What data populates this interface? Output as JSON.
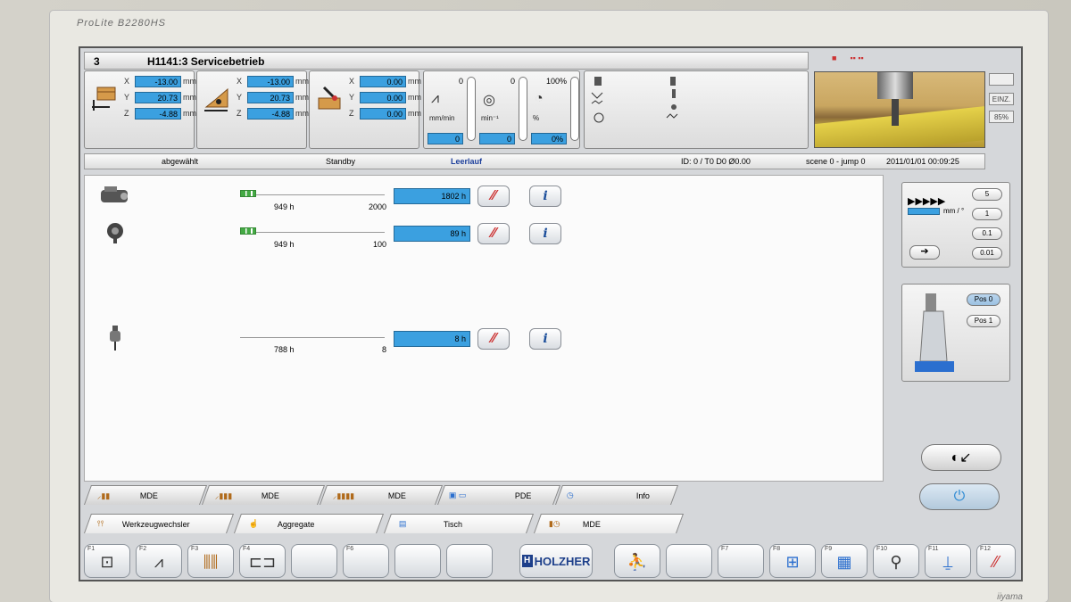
{
  "monitor": {
    "brand": "ProLite B2280HS",
    "maker": "iiyama"
  },
  "header": {
    "number": "3",
    "title": "H1141:3 Servicebetrieb"
  },
  "axes_panels": [
    {
      "x": "-13.00",
      "y": "20.73",
      "z": "-4.88",
      "unit": "mm"
    },
    {
      "x": "-13.00",
      "y": "20.73",
      "z": "-4.88",
      "unit": "mm"
    },
    {
      "x": "0.00",
      "y": "0.00",
      "z": "0.00",
      "unit": "mm"
    }
  ],
  "gauges": {
    "feed": {
      "top": "0",
      "unit": "mm/min",
      "value": "0"
    },
    "speed": {
      "top": "0",
      "unit": "min⁻¹",
      "value": "0"
    },
    "override": {
      "top": "100%",
      "unit": "%",
      "value": "0%"
    }
  },
  "side_labels": {
    "einz": "EINZ.",
    "pct": "85%"
  },
  "statusbar": {
    "selection": "abgewählt",
    "mode": "Standby",
    "state": "Leerlauf",
    "tool_id": "ID: 0 / T0 D0 Ø0.00",
    "scene": "scene 0 - jump 0",
    "datetime": "2011/01/01 00:09:25"
  },
  "rows": [
    {
      "hours": "949 h",
      "limit": "2000",
      "counter": "1802 h"
    },
    {
      "hours": "949 h",
      "limit": "100",
      "counter": "89 h"
    },
    {
      "hours": "788 h",
      "limit": "8",
      "counter": "8 h"
    }
  ],
  "jog": {
    "unit": "mm / °",
    "steps": [
      "5",
      "1",
      "0.1",
      "0.01"
    ]
  },
  "positions": [
    "Pos 0",
    "Pos 1"
  ],
  "tabs_upper": [
    "MDE",
    "MDE",
    "MDE",
    "PDE",
    "Info"
  ],
  "tabs_lower": [
    "Werkzeugwechsler",
    "Aggregate",
    "Tisch",
    "MDE"
  ],
  "fkeys": [
    "F1",
    "F2",
    "F3",
    "F4",
    "",
    "F6",
    "",
    "",
    "",
    "F7",
    "",
    "F8",
    "F9",
    "F10",
    "F11",
    "F12"
  ],
  "logo": "HOLZHER",
  "colors": {
    "value_field": "#3ba0e0",
    "accent": "#1d3f8a",
    "reset": "#cc3333"
  }
}
